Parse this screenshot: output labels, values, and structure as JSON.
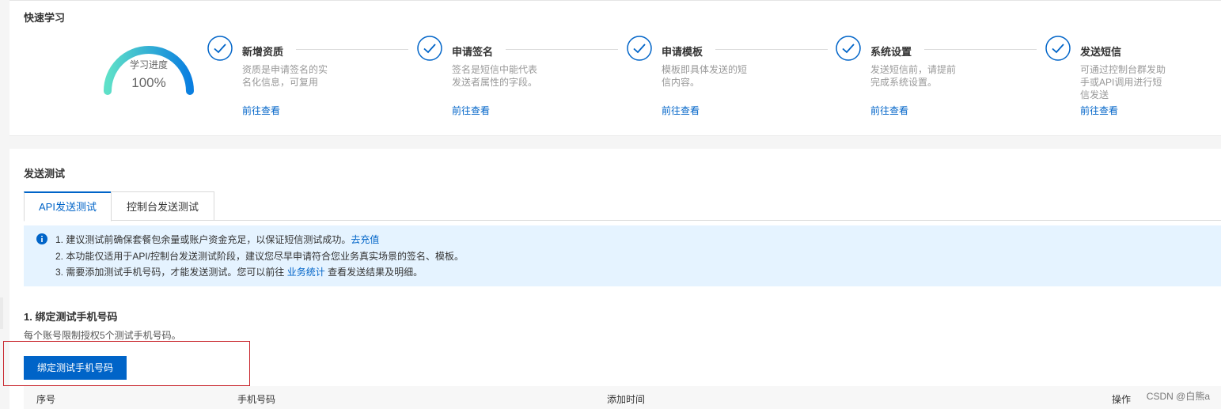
{
  "learn": {
    "title": "快速学习",
    "progress_label": "学习进度",
    "progress_value": "100%",
    "progress_fraction": 1.0,
    "steps": [
      {
        "title": "新增资质",
        "desc": "资质是申请签名的实名化信息，可复用",
        "link": "前往查看"
      },
      {
        "title": "申请签名",
        "desc": "签名是短信中能代表发送者属性的字段。",
        "link": "前往查看"
      },
      {
        "title": "申请模板",
        "desc": "模板即具体发送的短信内容。",
        "link": "前往查看"
      },
      {
        "title": "系统设置",
        "desc": "发送短信前，请提前完成系统设置。",
        "link": "前往查看"
      },
      {
        "title": "发送短信",
        "desc": "可通过控制台群发助手或API调用进行短信发送",
        "link": "前往查看"
      }
    ]
  },
  "test": {
    "title": "发送测试",
    "tabs": [
      {
        "label": "API发送测试",
        "active": true
      },
      {
        "label": "控制台发送测试",
        "active": false
      }
    ],
    "notice": {
      "line1_text": "1. 建议测试前确保套餐包余量或账户资金充足，以保证短信测试成功。",
      "line1_link": "去充值",
      "line2_text": "2. 本功能仅适用于API/控制台发送测试阶段，建议您尽早申请符合您业务真实场景的签名、模板。",
      "line3_prefix": "3. 需要添加测试手机号码，才能发送测试。您可以前往",
      "line3_link": "业务统计",
      "line3_suffix": "查看发送结果及明细。"
    },
    "bind": {
      "title": "1. 绑定测试手机号码",
      "desc": "每个账号限制授权5个测试手机号码。",
      "button": "绑定测试手机号码"
    },
    "table": {
      "columns": [
        "序号",
        "手机号码",
        "添加时间",
        "操作"
      ]
    }
  },
  "watermark": "CSDN @白熊a",
  "colors": {
    "primary": "#0064c8",
    "notice_bg": "#e5f3ff",
    "gauge_start": "#5ee0c8",
    "gauge_end": "#0a7fe0",
    "highlight_border": "#c8242b"
  }
}
